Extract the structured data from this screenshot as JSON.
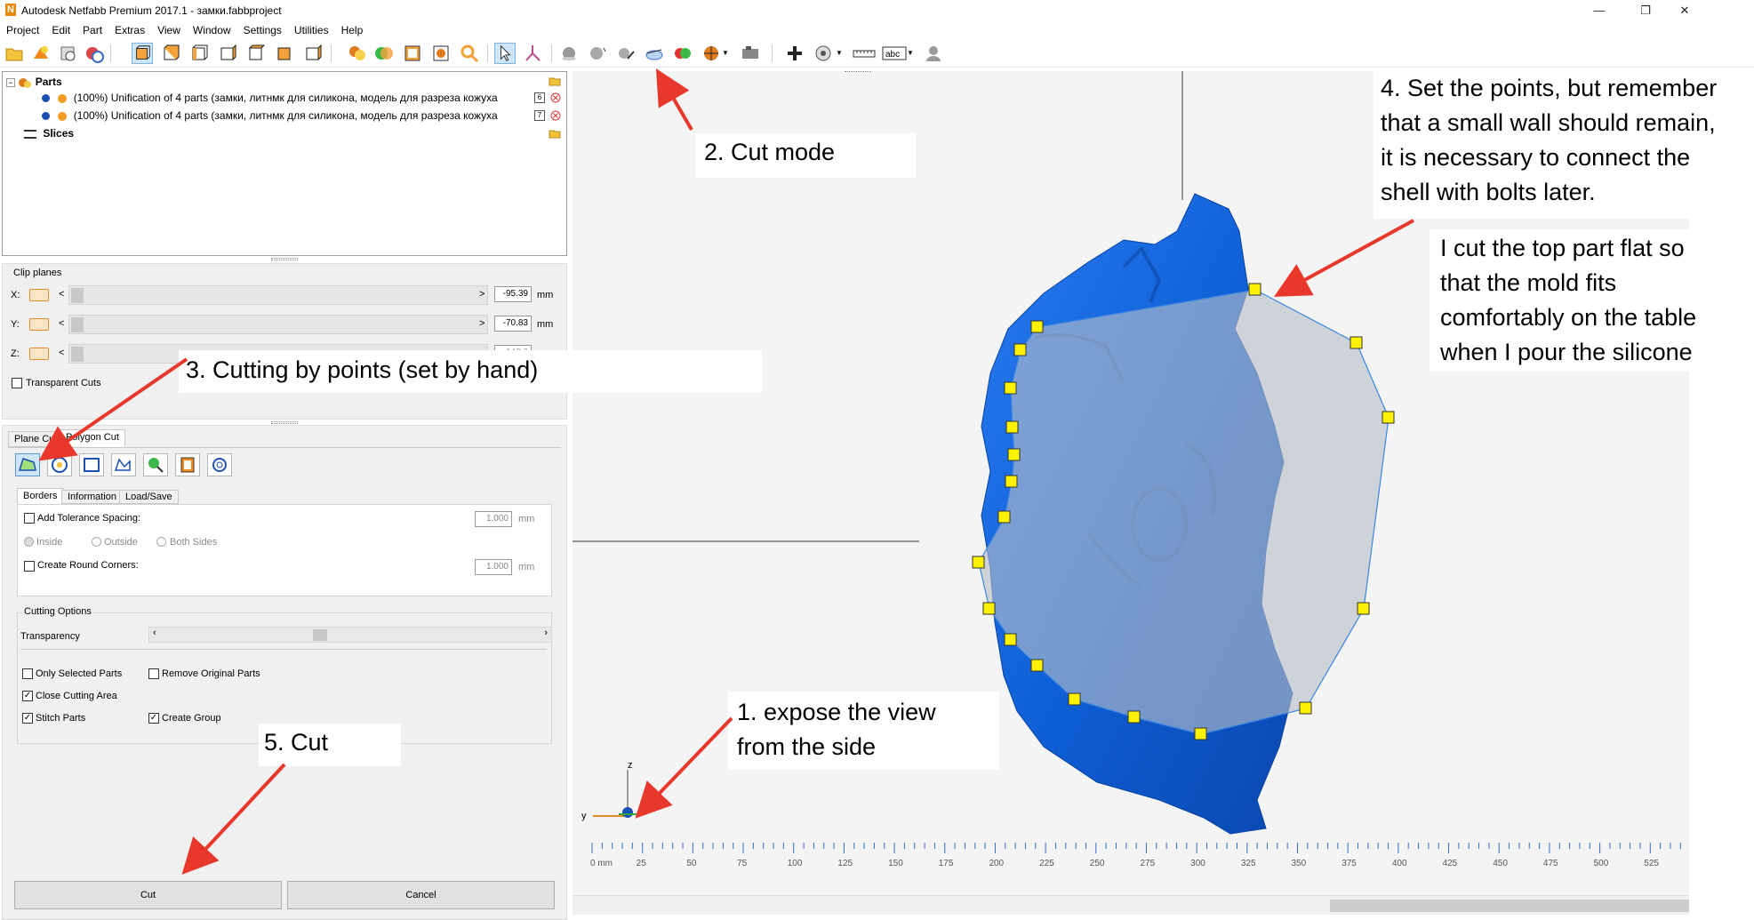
{
  "window": {
    "title": "Autodesk Netfabb Premium 2017.1 - замки.fabbproject",
    "app_icon_letter": "N",
    "minimize": "—",
    "maximize": "❐",
    "close": "✕"
  },
  "menu": [
    "Project",
    "Edit",
    "Part",
    "Extras",
    "View",
    "Window",
    "Settings",
    "Utilities",
    "Help"
  ],
  "tree": {
    "parts_label": "Parts",
    "items": [
      {
        "label": "(100%) Unification of 4 parts (замки, литнмк для силикона, модель для разреза кожуха",
        "badge": "6"
      },
      {
        "label": "(100%) Unification of 4 parts (замки, литнмк для силикона, модель для разреза кожуха",
        "badge": "7"
      }
    ],
    "slices_label": "Slices"
  },
  "clip_planes": {
    "title": "Clip planes",
    "x_label": "X:",
    "y_label": "Y:",
    "z_label": "Z:",
    "x_value": "-95.39",
    "y_value": "-70.83",
    "z_value": "-143.6",
    "unit": "mm",
    "left_arrow": "<",
    "right_arrow": ">",
    "transparent_cuts": "Transparent Cuts"
  },
  "cut_panel": {
    "tabs": [
      "Plane Cut",
      "Polygon Cut"
    ],
    "active_tab": "Polygon Cut",
    "subtabs": [
      "Borders",
      "Information",
      "Load/Save"
    ],
    "add_tolerance": "Add Tolerance Spacing:",
    "tolerance_value": "1.000",
    "unit": "mm",
    "inside": "Inside",
    "outside": "Outside",
    "both_sides": "Both Sides",
    "round_corners": "Create Round Corners:",
    "round_value": "1.000",
    "cutting_options": "Cutting Options",
    "transparency": "Transparency",
    "transparency_level": 0.42,
    "only_selected": "Only Selected Parts",
    "remove_original": "Remove Original Parts",
    "close_cutting_area": "Close Cutting Area",
    "stitch_parts": "Stitch Parts",
    "create_group": "Create Group",
    "check": "✓",
    "cut_button": "Cut",
    "cancel_button": "Cancel"
  },
  "axis_labels": {
    "z": "z",
    "y": "y"
  },
  "ruler": {
    "labels": [
      "0 mm",
      "25",
      "50",
      "75",
      "100",
      "125",
      "150",
      "175",
      "200",
      "225",
      "250",
      "275",
      "300",
      "325",
      "350",
      "375",
      "400",
      "425",
      "450",
      "475",
      "500",
      "525"
    ]
  },
  "annotations": {
    "cut_mode": "2. Cut mode",
    "cutting_by_points": "3. Cutting by points (set by hand)",
    "expose_view": "1. expose the view\nfrom the side",
    "set_points": "4. Set the points, but remember\nthat a small wall should remain,\nit is necessary to connect the\nshell with bolts later.",
    "top_flat": "I cut the top part flat so\nthat the mold fits\ncomfortably on the table\nwhen I pour the silicone",
    "cut": "5. Cut"
  },
  "colors": {
    "model_blue": "#0f5fd6",
    "cut_overlay": "#a8b6c6",
    "point_yellow": "#fff200",
    "arrow_red": "#e8382b",
    "selection_blue": "#cfe5fb"
  }
}
